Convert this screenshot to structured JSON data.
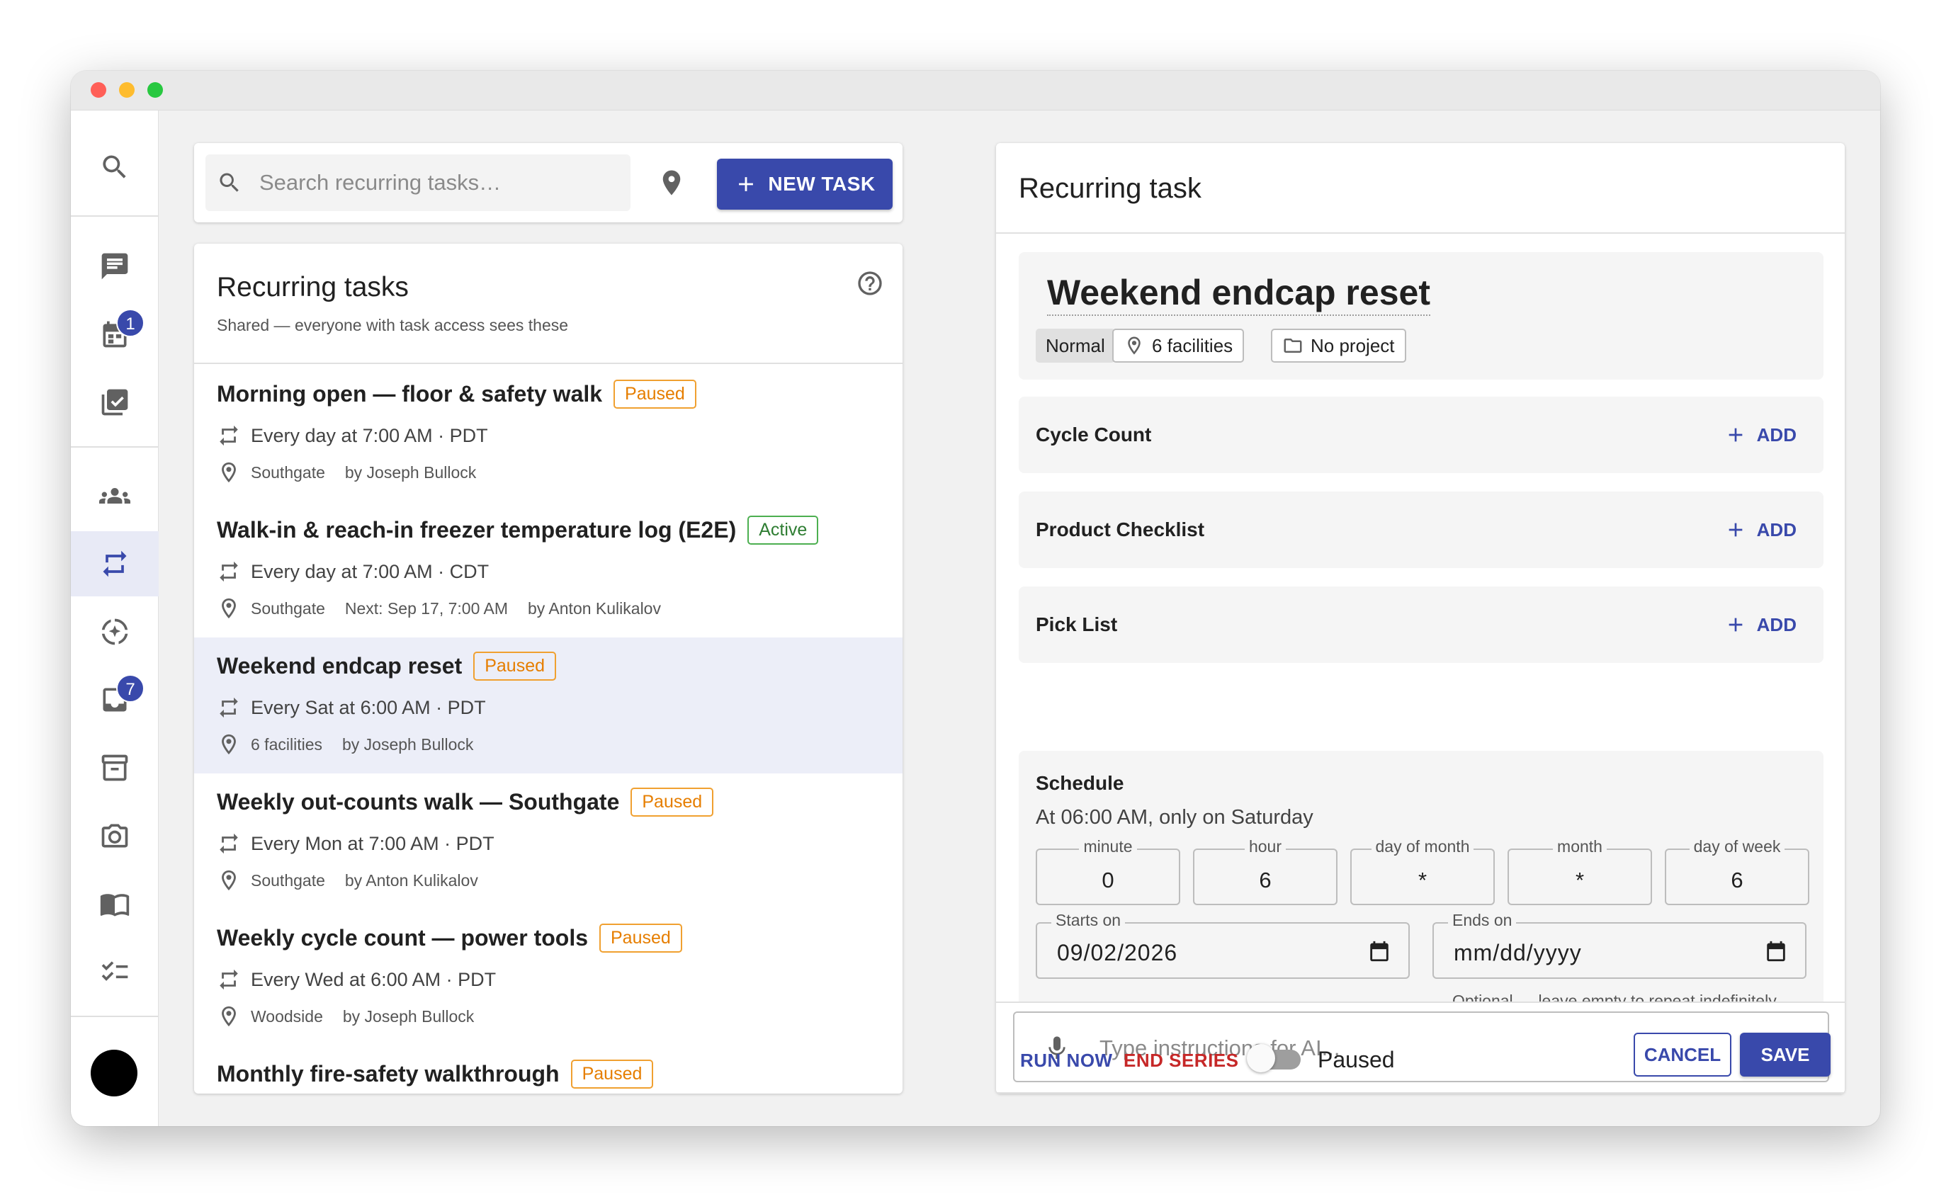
{
  "search": {
    "placeholder": "Search recurring tasks…"
  },
  "toolbar": {
    "new_task_label": "NEW TASK"
  },
  "rail": {
    "badges": {
      "calendar": "1",
      "inbox": "7"
    }
  },
  "list": {
    "title": "Recurring tasks",
    "subtitle": "Shared — everyone with task access sees these",
    "items": [
      {
        "title": "Morning open — floor & safety walk",
        "status": "Paused",
        "schedule": "Every day at 7:00 AM · PDT",
        "location": "Southgate",
        "next": "",
        "author": "by Joseph Bullock"
      },
      {
        "title": "Walk-in & reach-in freezer temperature log (E2E)",
        "status": "Active",
        "schedule": "Every day at 7:00 AM · CDT",
        "location": "Southgate",
        "next": "Next: Sep 17, 7:00 AM",
        "author": "by Anton Kulikalov"
      },
      {
        "title": "Weekend endcap reset",
        "status": "Paused",
        "schedule": "Every Sat at 6:00 AM · PDT",
        "location": "6 facilities",
        "next": "",
        "author": "by Joseph Bullock"
      },
      {
        "title": "Weekly out-counts walk — Southgate",
        "status": "Paused",
        "schedule": "Every Mon at 7:00 AM · PDT",
        "location": "Southgate",
        "next": "",
        "author": "by Anton Kulikalov"
      },
      {
        "title": "Weekly cycle count — power tools",
        "status": "Paused",
        "schedule": "Every Wed at 6:00 AM · PDT",
        "location": "Woodside",
        "next": "",
        "author": "by Joseph Bullock"
      },
      {
        "title": "Monthly fire-safety walkthrough",
        "status": "Paused",
        "schedule": "",
        "location": "",
        "next": "",
        "author": ""
      }
    ]
  },
  "detail": {
    "header": "Recurring task",
    "title": "Weekend endcap reset",
    "priority": "Normal",
    "facilities": "6 facilities",
    "project": "No project",
    "sections": [
      {
        "label": "Cycle Count",
        "action": "ADD"
      },
      {
        "label": "Product Checklist",
        "action": "ADD"
      },
      {
        "label": "Pick List",
        "action": "ADD"
      }
    ],
    "schedule": {
      "title": "Schedule",
      "description": "At 06:00 AM, only on Saturday",
      "fields": {
        "minute": {
          "label": "minute",
          "value": "0"
        },
        "hour": {
          "label": "hour",
          "value": "6"
        },
        "day_of_month": {
          "label": "day of month",
          "value": "*"
        },
        "month": {
          "label": "month",
          "value": "*"
        },
        "day_of_week": {
          "label": "day of week",
          "value": "6"
        }
      },
      "starts_on": {
        "label": "Starts on",
        "value": "09/02/2026"
      },
      "ends_on": {
        "label": "Ends on",
        "placeholder": "mm/dd/yyyy"
      },
      "hint": "Optional — leave empty to repeat indefinitely"
    },
    "ai": {
      "placeholder": "Type instructions for AI..."
    },
    "footer": {
      "run_now": "RUN NOW",
      "end_series": "END SERIES",
      "toggle_label": "Paused",
      "cancel": "CANCEL",
      "save": "SAVE"
    }
  },
  "colors": {
    "primary": "#3949ab",
    "paused": "#e67e00",
    "active": "#2e7d32",
    "danger": "#c62828",
    "selected_row": "#eceef8"
  },
  "icons": [
    "search-icon",
    "chat-icon",
    "calendar-icon",
    "checklist-icon",
    "people-icon",
    "repeat-icon",
    "ai-sparkle-icon",
    "inbox-icon",
    "archive-icon",
    "camera-icon",
    "book-icon",
    "task-list-icon",
    "location-pin-icon",
    "plus-icon",
    "help-icon",
    "folder-icon",
    "microphone-icon",
    "send-icon"
  ]
}
